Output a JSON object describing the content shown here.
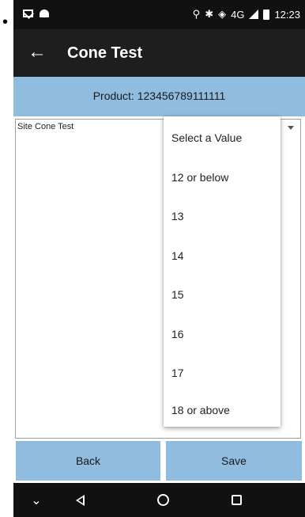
{
  "bullet": "•",
  "status_bar": {
    "icons_left": [
      "mail-icon",
      "android-icon"
    ],
    "icons_right": [
      "location-icon",
      "bluetooth-icon",
      "wifi-icon",
      "signal-icon",
      "battery-icon"
    ],
    "location_glyph": "⚲",
    "bluetooth_glyph": "✱",
    "wifi_glyph": "◈",
    "network": "4G",
    "time": "12:23"
  },
  "app_bar": {
    "back_glyph": "←",
    "title": "Cone Test"
  },
  "product": {
    "text": "Product: 123456789111111"
  },
  "form": {
    "spinner_label": "Site Cone Test"
  },
  "dropdown": {
    "options": [
      "Select a Value",
      "12 or below",
      "13",
      "14",
      "15",
      "16",
      "17",
      "18 or above"
    ]
  },
  "buttons": {
    "back_label": "Back",
    "save_label": "Save"
  },
  "nav_bar": {
    "down_glyph": "⌄"
  },
  "colors": {
    "accent": "#8fbcdf",
    "app_bar": "#1e1e1e",
    "status_bar": "#111111"
  }
}
